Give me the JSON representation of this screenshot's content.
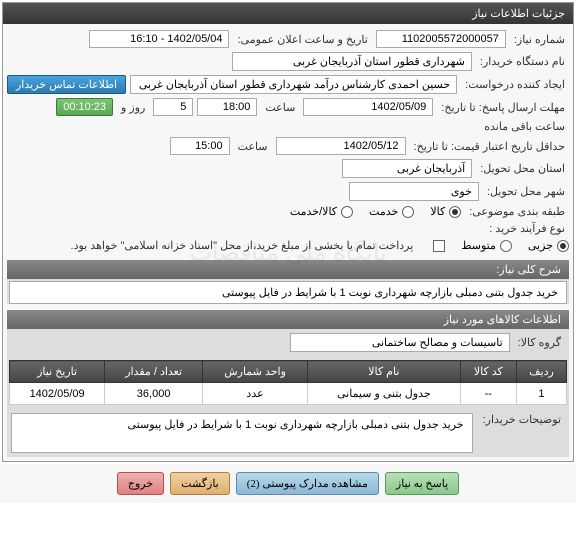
{
  "panel": {
    "title": "جزئیات اطلاعات نیاز"
  },
  "fields": {
    "need_number_label": "شماره نیاز:",
    "need_number": "1102005572000057",
    "announce_label": "تاریخ و ساعت اعلان عمومی:",
    "announce_value": "1402/05/04 - 16:10",
    "buyer_org_label": "نام دستگاه خریدار:",
    "buyer_org": "شهرداری قطور استان آذربایجان غربی",
    "creator_label": "ایجاد کننده درخواست:",
    "creator": "حسین احمدی کارشناس درآمد شهرداری قطور استان آذربایجان غربی",
    "contact_btn": "اطلاعات تماس خریدار",
    "deadline_label": "مهلت ارسال پاسخ: تا تاریخ:",
    "deadline_date": "1402/05/09",
    "deadline_time_label": "ساعت",
    "deadline_time": "18:00",
    "days_label": "روز و",
    "days_value": "5",
    "remaining_label": "ساعت باقی مانده",
    "remaining_time": "00:10:23",
    "validity_label": "حداقل تاریخ اعتبار قیمت: تا تاریخ:",
    "validity_date": "1402/05/12",
    "validity_time": "15:00",
    "province_label": "استان محل تحویل:",
    "province": "آذربایجان غربی",
    "city_label": "شهر محل تحویل:",
    "city": "خوی",
    "category_label": "طبقه بندی موضوعی:",
    "cat_goods": "کالا",
    "cat_service": "خدمت",
    "cat_both": "کالا/خدمت",
    "process_label": "نوع فرآیند خرید :",
    "process_partial": "جزیی",
    "process_medium": "متوسط",
    "payment_note": "پرداخت تمام یا بخشی از مبلغ خرید،از محل \"اسناد خزانه اسلامی\" خواهد بود.",
    "desc_header": "شرح کلی نیاز:",
    "desc_text": "خرید جدول بتنی دمبلی بازارچه شهرداری نوبت 1 با شرایط در فایل پیوستی",
    "items_header": "اطلاعات کالاهای مورد نیاز",
    "group_label": "گروه کالا:",
    "group_value": "تاسیسات و مصالح ساختمانی",
    "buyer_notes_label": "توضیحات خریدار:",
    "buyer_notes": "خرید جدول بتنی دمبلی بازارچه شهرداری نوبت 1 با شرایط در فایل پیوستی"
  },
  "table": {
    "headers": {
      "row": "ردیف",
      "code": "کد کالا",
      "name": "نام کالا",
      "unit": "واحد شمارش",
      "qty": "تعداد / مقدار",
      "date": "تاریخ نیاز"
    },
    "rows": [
      {
        "row": "1",
        "code": "--",
        "name": "جدول بتنی و سیمانی",
        "unit": "عدد",
        "qty": "36,000",
        "date": "1402/05/09"
      }
    ]
  },
  "footer": {
    "reply": "پاسخ به نیاز",
    "docs": "مشاهده مدارک پیوستی (2)",
    "back": "بازگشت",
    "exit": "خروج"
  },
  "watermark": "پایگاه ملی مناقصات"
}
